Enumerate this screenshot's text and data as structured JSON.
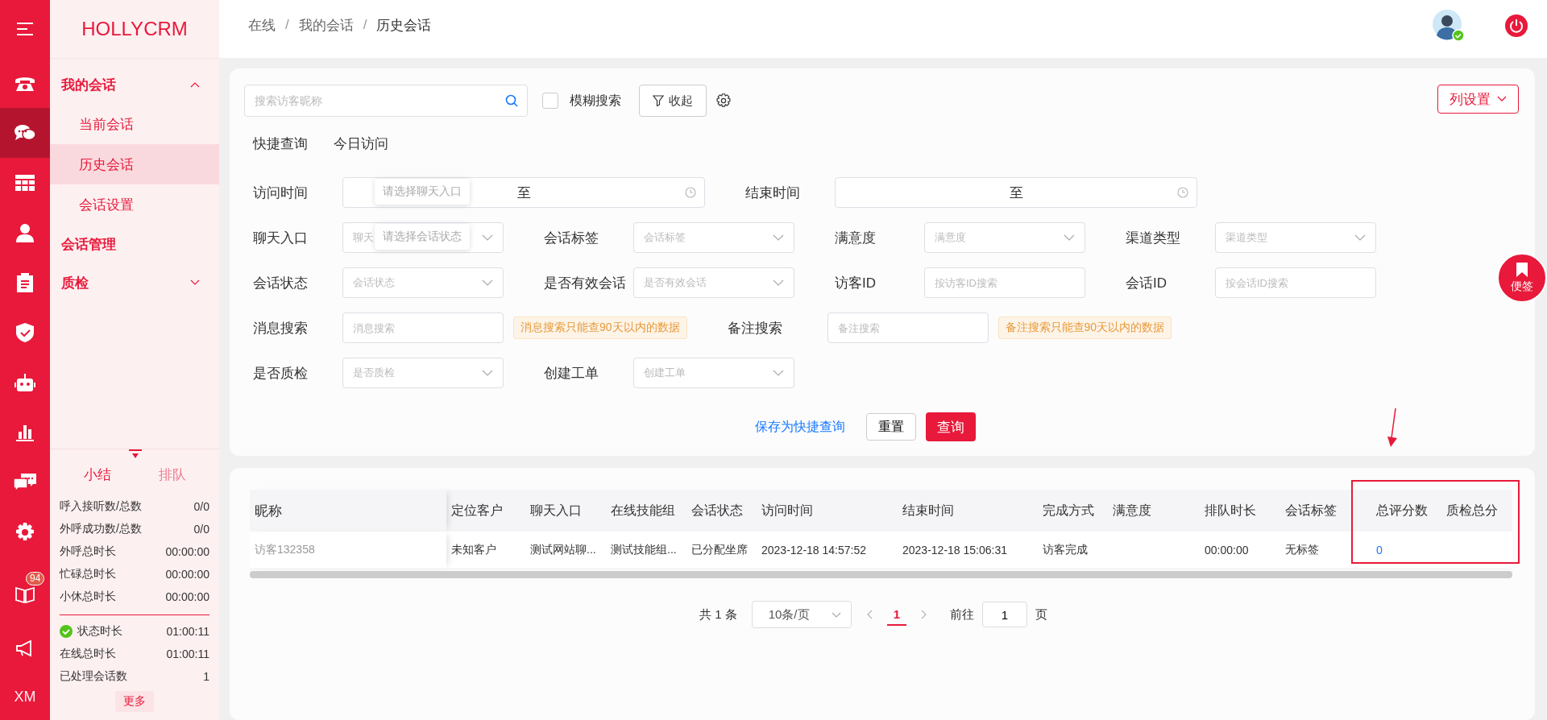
{
  "rail": {
    "items": [
      {
        "kind": "menu",
        "selected": false
      },
      {
        "kind": "phone",
        "selected": false
      },
      {
        "kind": "chat",
        "selected": true
      },
      {
        "kind": "grid",
        "selected": false
      },
      {
        "kind": "person",
        "selected": false
      },
      {
        "kind": "clipboard",
        "selected": false
      },
      {
        "kind": "shield",
        "selected": false
      },
      {
        "kind": "robot",
        "selected": false
      },
      {
        "kind": "bars",
        "selected": false
      },
      {
        "kind": "messages",
        "selected": false
      },
      {
        "kind": "gear",
        "selected": false
      }
    ],
    "bottom": [
      {
        "kind": "book",
        "badge": "94"
      },
      {
        "kind": "megaphone"
      },
      {
        "kind": "text",
        "label": "XM"
      }
    ]
  },
  "sidebar": {
    "logo": "HOLLYCRM",
    "groups": [
      {
        "label": "我的会话",
        "expanded": true,
        "children": [
          {
            "label": "当前会话",
            "selected": false
          },
          {
            "label": "历史会话",
            "selected": true
          },
          {
            "label": "会话设置",
            "selected": false
          }
        ]
      },
      {
        "label": "会话管理"
      },
      {
        "label": "质检",
        "expanded": false
      }
    ],
    "stats": {
      "tabs": [
        {
          "label": "小结",
          "selected": true
        },
        {
          "label": "排队",
          "selected": false
        }
      ],
      "rows": [
        {
          "label": "呼入接听数/总数",
          "value": "0/0"
        },
        {
          "label": "外呼成功数/总数",
          "value": "0/0"
        },
        {
          "label": "外呼总时长",
          "value": "00:00:00"
        },
        {
          "label": "忙碌总时长",
          "value": "00:00:00"
        },
        {
          "label": "小休总时长",
          "value": "00:00:00"
        }
      ],
      "status_rows": [
        {
          "label": "状态时长",
          "value": "01:00:11",
          "status_ok": true
        },
        {
          "label": "在线总时长",
          "value": "01:00:11"
        },
        {
          "label": "已处理会话数",
          "value": "1"
        }
      ],
      "more": "更多"
    }
  },
  "header": {
    "breadcrumb": [
      {
        "label": "在线",
        "separator": "/"
      },
      {
        "label": "我的会话",
        "separator": "/"
      },
      {
        "label": "历史会话"
      }
    ],
    "online": true
  },
  "filter": {
    "search": {
      "placeholder": "搜索访客昵称"
    },
    "fuzzy": {
      "label": "模糊搜索",
      "checked": false
    },
    "collapse": "收起",
    "column_settings": "列设置",
    "quick": {
      "label": "快捷查询",
      "items": [
        "今日访问"
      ]
    },
    "rows": [
      [
        {
          "label": "访问时间",
          "kind": "daterange",
          "separator": "至"
        },
        {
          "label": "结束时间",
          "kind": "daterange",
          "separator": "至"
        }
      ],
      [
        {
          "label": "聊天入口",
          "kind": "select",
          "placeholder": "聊天"
        },
        {
          "label": "会话标签",
          "kind": "select",
          "placeholder": "会话标签"
        },
        {
          "label": "满意度",
          "kind": "select",
          "placeholder": "满意度"
        },
        {
          "label": "渠道类型",
          "kind": "select",
          "placeholder": "渠道类型"
        }
      ],
      [
        {
          "label": "会话状态",
          "kind": "select",
          "placeholder": "会话状态"
        },
        {
          "label": "是否有效会话",
          "kind": "select",
          "placeholder": "是否有效会话"
        },
        {
          "label": "访客ID",
          "kind": "input",
          "placeholder": "按访客ID搜索"
        },
        {
          "label": "会话ID",
          "kind": "input",
          "placeholder": "按会话ID搜索"
        }
      ],
      [
        {
          "label": "消息搜索",
          "kind": "input",
          "placeholder": "消息搜索",
          "note": "消息搜索只能查90天以内的数据"
        },
        {
          "label": "备注搜索",
          "kind": "input",
          "placeholder": "备注搜索",
          "note": "备注搜索只能查90天以内的数据"
        }
      ],
      [
        {
          "label": "是否质检",
          "kind": "select",
          "placeholder": "是否质检"
        },
        {
          "label": "创建工单",
          "kind": "select",
          "placeholder": "创建工单"
        }
      ]
    ],
    "tooltips": [
      "请选择聊天入口",
      "请选择会话状态"
    ],
    "save_quick": "保存为快捷查询",
    "reset": "重置",
    "query": "查询"
  },
  "table": {
    "columns": [
      "昵称",
      "定位客户",
      "聊天入口",
      "在线技能组",
      "会话状态",
      "访问时间",
      "结束时间",
      "完成方式",
      "满意度",
      "排队时长",
      "会话标签",
      "总评分数",
      "质检总分"
    ],
    "rows": [
      {
        "cells": [
          "访客132358",
          "未知客户",
          "测试网站聊...",
          "测试技能组...",
          "已分配坐席",
          "2023-12-18 14:57:52",
          "2023-12-18 15:06:31",
          "访客完成",
          "",
          "00:00:00",
          "无标签",
          "0",
          ""
        ]
      }
    ]
  },
  "pagination": {
    "total": "共 1 条",
    "page_size": "10条/页",
    "pages": [
      {
        "label": "1",
        "selected": true
      }
    ],
    "goto": "前往",
    "goto_value": "1",
    "page_unit": "页"
  },
  "note_button": "便签"
}
